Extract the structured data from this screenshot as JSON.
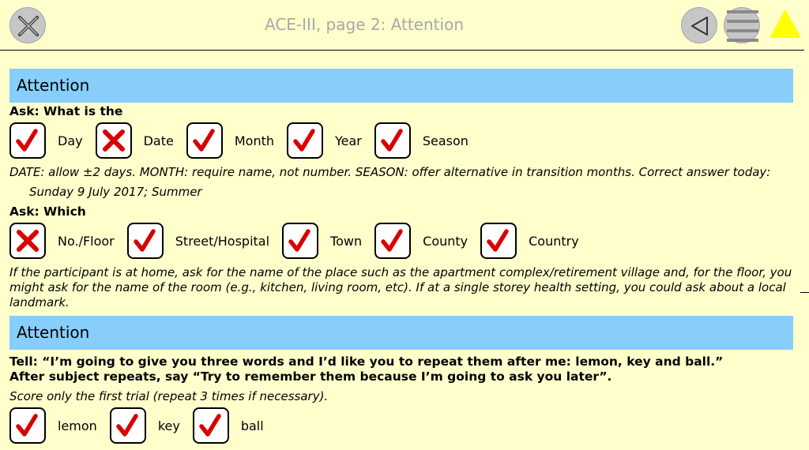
{
  "header": {
    "title": "ACE-III, page 2: Attention",
    "icons": {
      "close": "close-icon",
      "back": "back-icon",
      "menu": "menu-icon",
      "alert": "warning-triangle-icon"
    }
  },
  "sections": [
    {
      "header": "Attention",
      "ask": "Ask: What is the",
      "items": [
        {
          "label": "Day",
          "state": "correct"
        },
        {
          "label": "Date",
          "state": "incorrect"
        },
        {
          "label": "Month",
          "state": "correct"
        },
        {
          "label": "Year",
          "state": "correct"
        },
        {
          "label": "Season",
          "state": "correct"
        }
      ],
      "note": "DATE: allow ±2 days. MONTH: require name, not number. SEASON: offer alternative in transition months. Correct answer today:",
      "answer": "Sunday 9 July 2017; Summer",
      "ask2": "Ask: Which",
      "items2": [
        {
          "label": "No./Floor",
          "state": "incorrect"
        },
        {
          "label": "Street/Hospital",
          "state": "correct"
        },
        {
          "label": "Town",
          "state": "correct"
        },
        {
          "label": "County",
          "state": "correct"
        },
        {
          "label": "Country",
          "state": "correct"
        }
      ],
      "note2": "If the participant is at home, ask for the name of the place such as the apartment complex/retirement village and, for the floor, you might ask for the name of the room (e.g., kitchen, living room, etc). If at a single storey health setting, you could ask about a local landmark."
    },
    {
      "header": "Attention",
      "tell": "Tell: “I’m going to give you three words and I’d like you to repeat them after me: lemon, key and ball.”",
      "after": "After subject repeats, say “Try to remember them because I’m going to ask you later”.",
      "score_note": "Score only the first trial (repeat 3 times if necessary).",
      "items": [
        {
          "label": "lemon",
          "state": "correct"
        },
        {
          "label": "key",
          "state": "correct"
        },
        {
          "label": "ball",
          "state": "correct"
        }
      ]
    }
  ],
  "colors": {
    "background": "#ffffcc",
    "section_header": "#87cefa",
    "tick": "#d90000",
    "alert": "#ffff00"
  }
}
